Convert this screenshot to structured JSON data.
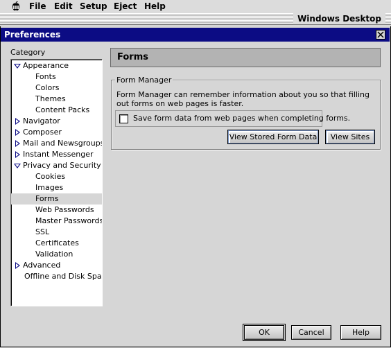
{
  "menubar": {
    "apple_icon": "apple-icon",
    "items": [
      "File",
      "Edit",
      "Setup",
      "Eject",
      "Help"
    ],
    "desktop_title": "Windows Desktop"
  },
  "window": {
    "title": "Preferences",
    "close_icon": "close-icon"
  },
  "category": {
    "label": "Category",
    "items": [
      {
        "label": "Appearance",
        "level": 0,
        "state": "expanded"
      },
      {
        "label": "Fonts",
        "level": 1
      },
      {
        "label": "Colors",
        "level": 1
      },
      {
        "label": "Themes",
        "level": 1
      },
      {
        "label": "Content Packs",
        "level": 1
      },
      {
        "label": "Navigator",
        "level": 0,
        "state": "collapsed"
      },
      {
        "label": "Composer",
        "level": 0,
        "state": "collapsed"
      },
      {
        "label": "Mail and Newsgroups",
        "level": 0,
        "state": "collapsed"
      },
      {
        "label": "Instant Messenger",
        "level": 0,
        "state": "collapsed"
      },
      {
        "label": "Privacy and Security",
        "level": 0,
        "state": "expanded"
      },
      {
        "label": "Cookies",
        "level": 1
      },
      {
        "label": "Images",
        "level": 1
      },
      {
        "label": "Forms",
        "level": 1,
        "selected": true
      },
      {
        "label": "Web Passwords",
        "level": 1
      },
      {
        "label": "Master Passwords",
        "level": 1
      },
      {
        "label": "SSL",
        "level": 1
      },
      {
        "label": "Certificates",
        "level": 1
      },
      {
        "label": "Validation",
        "level": 1
      },
      {
        "label": "Advanced",
        "level": 0,
        "state": "collapsed"
      },
      {
        "label": "Offline and Disk Space",
        "level": 0
      }
    ]
  },
  "panel": {
    "title": "Forms",
    "group_label": "Form Manager",
    "description": "Form Manager can remember information about you so that filling out forms on web pages is faster.",
    "checkbox_label": "Save form data from web pages when completing forms.",
    "checkbox_checked": false,
    "view_stored_button": "View Stored Form Data",
    "view_sites_button": "View Sites"
  },
  "footer": {
    "ok": "OK",
    "cancel": "Cancel",
    "help": "Help"
  },
  "colors": {
    "title_bar": "#0c0c84",
    "tree_arrow": "#0c0c84",
    "window_bg": "#d6d6d6"
  }
}
